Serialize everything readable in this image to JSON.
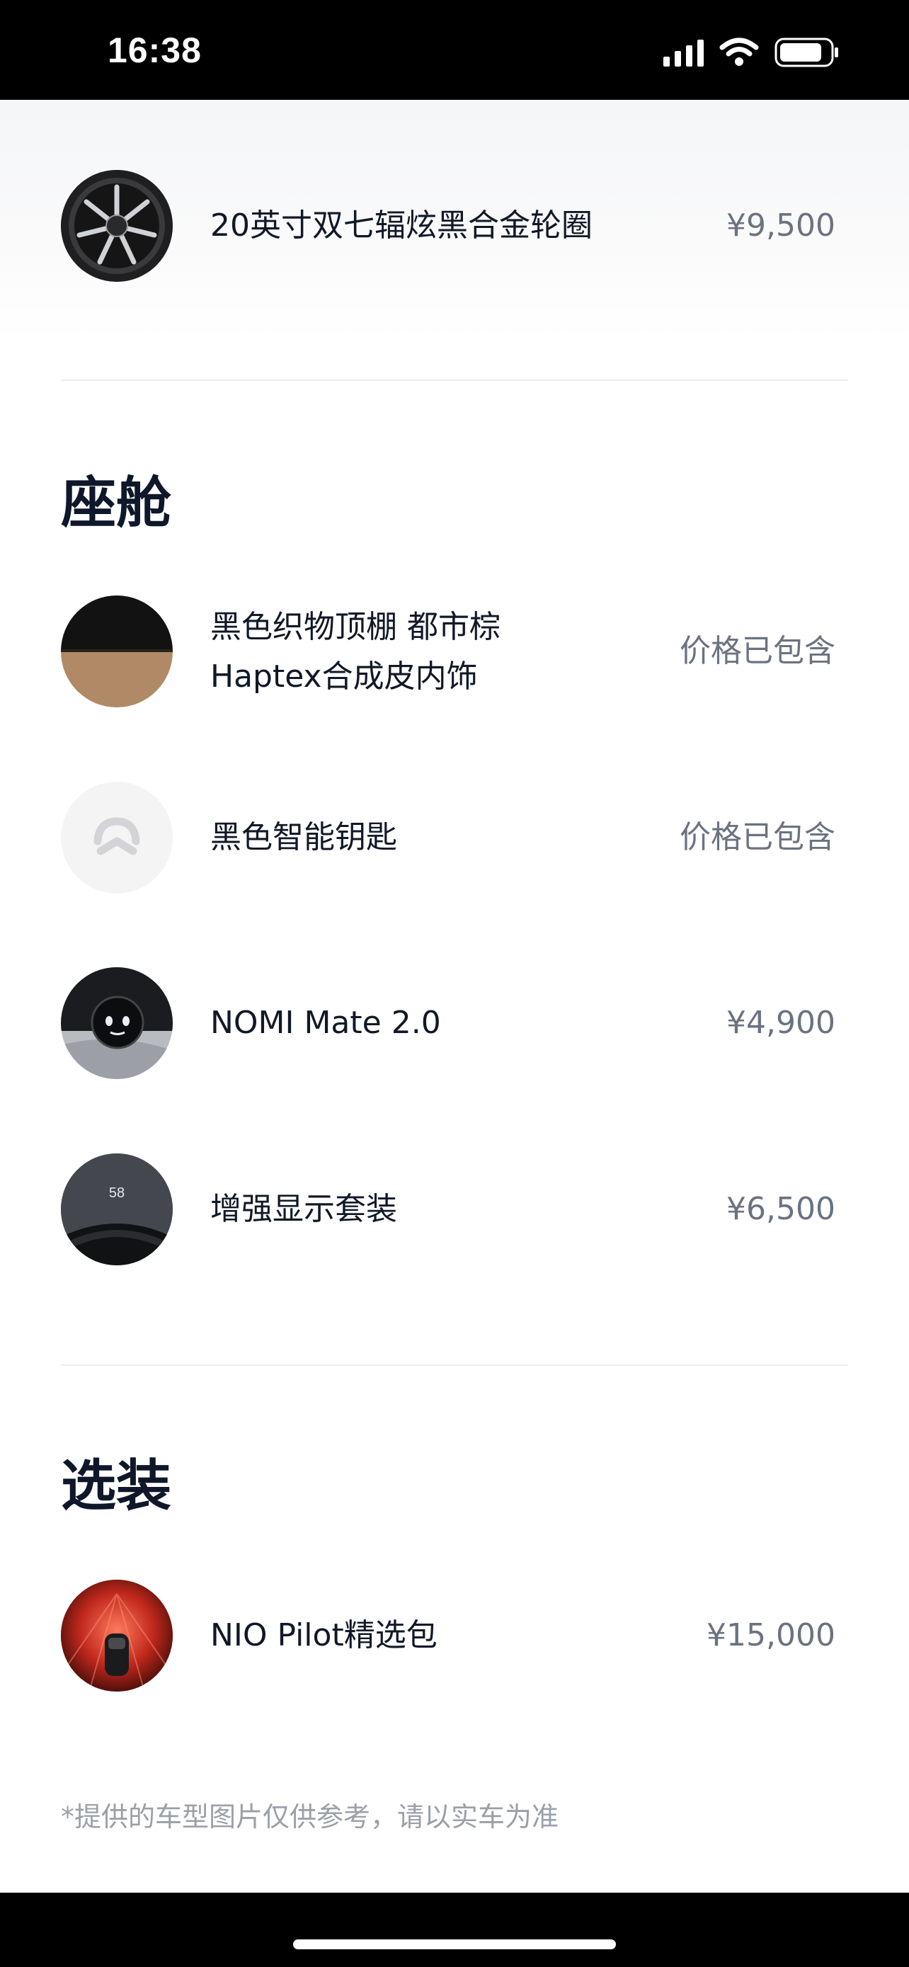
{
  "status_bar": {
    "time": "16:38"
  },
  "sections": {
    "cabin_title": "座舱",
    "options_title": "选装"
  },
  "wheel_item": {
    "label": "20英寸双七辐炫黑合金轮圈",
    "price": "¥9,500"
  },
  "cabin_items": [
    {
      "label_line1": "黑色织物顶棚 都市棕",
      "label_line2": "Haptex合成皮内饰",
      "price": "价格已包含",
      "icon": "interior-swatch"
    },
    {
      "label": "黑色智能钥匙",
      "price": "价格已包含",
      "icon": "nio-logo"
    },
    {
      "label": "NOMI Mate 2.0",
      "price": "¥4,900",
      "icon": "nomi-device"
    },
    {
      "label": "增强显示套装",
      "price": "¥6,500",
      "icon": "hud-display",
      "thumb_text": "58"
    }
  ],
  "option_items": [
    {
      "label": "NIO Pilot精选包",
      "price": "¥15,000",
      "icon": "car-sensors"
    }
  ],
  "footnote": "*提供的车型图片仅供参考，请以实车为准"
}
